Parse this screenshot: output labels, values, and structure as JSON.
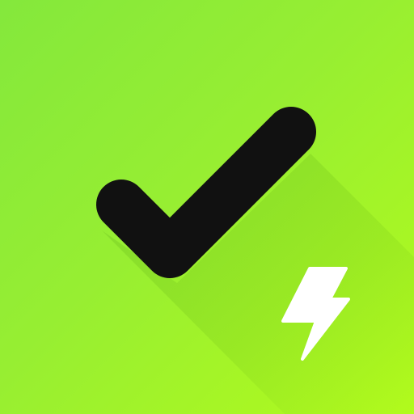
{
  "app_icon": {
    "name": "checkmark-bolt-app-icon",
    "background_gradient": [
      "#84e83c",
      "#b2fb1c"
    ],
    "checkmark_color": "#111111",
    "bolt_color": "#ffffff",
    "shadow_color": "#2f7a00"
  }
}
